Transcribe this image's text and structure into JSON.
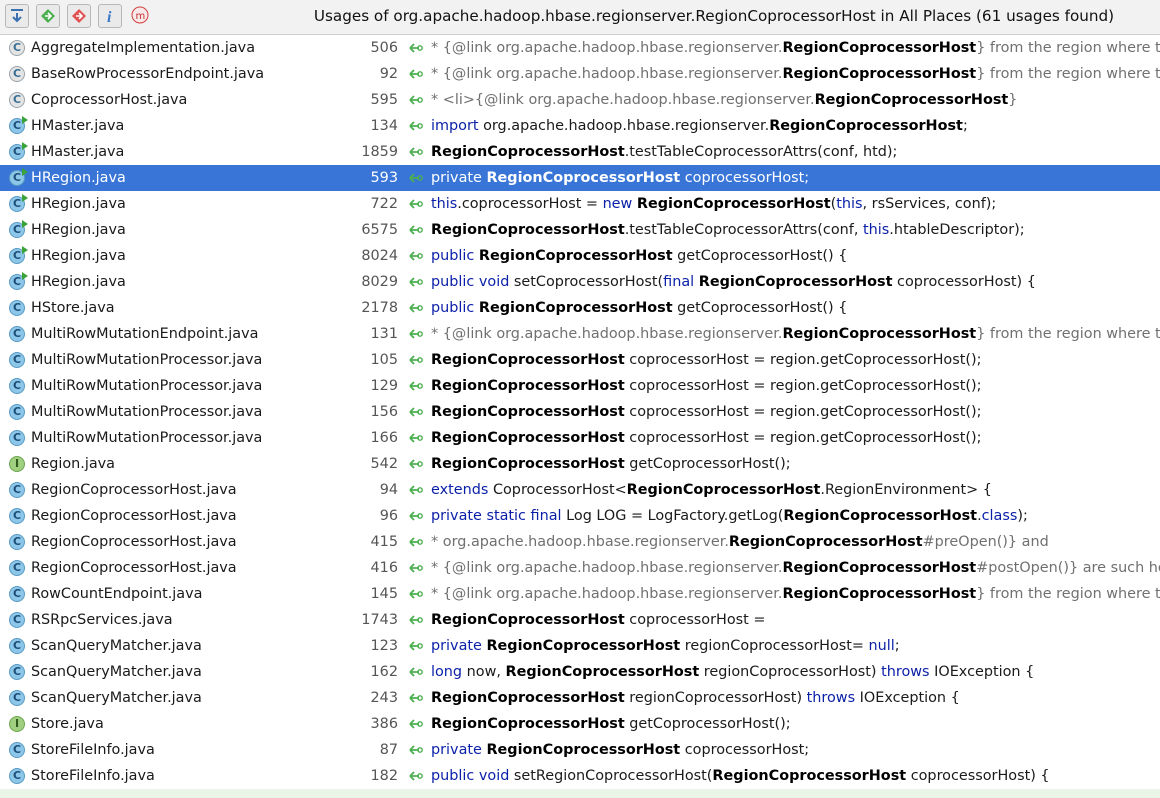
{
  "toolbar": {
    "buttons": [
      {
        "name": "expand-all-icon"
      },
      {
        "name": "next-occurrence-icon"
      },
      {
        "name": "previous-occurrence-icon"
      },
      {
        "name": "info-icon"
      },
      {
        "name": "merge-usages-icon"
      }
    ],
    "title": "Usages of org.apache.hadoop.hbase.regionserver.RegionCoprocessorHost in All Places (61 usages found)"
  },
  "colors": {
    "selection": "#3875d7",
    "keyword": "#0a1fa8",
    "comment": "#707070",
    "usage_arrow": "#4caf50"
  },
  "rows": [
    {
      "file": "AggregateImplementation.java",
      "icon": "abstract",
      "line": "506",
      "parts": [
        {
          "t": "  * {@link org.apache.hadoop.hbase.regionserver.",
          "s": "cm"
        },
        {
          "t": "RegionCoprocessorHost",
          "s": "b"
        },
        {
          "t": "} from the region where th",
          "s": "cm"
        }
      ]
    },
    {
      "file": "BaseRowProcessorEndpoint.java",
      "icon": "abstract",
      "line": "92",
      "parts": [
        {
          "t": "  * {@link org.apache.hadoop.hbase.regionserver.",
          "s": "cm"
        },
        {
          "t": "RegionCoprocessorHost",
          "s": "b"
        },
        {
          "t": "} from the region where th",
          "s": "cm"
        }
      ]
    },
    {
      "file": "CoprocessorHost.java",
      "icon": "abstract",
      "line": "595",
      "parts": [
        {
          "t": "  *   <li>{@link org.apache.hadoop.hbase.regionserver.",
          "s": "cm"
        },
        {
          "t": "RegionCoprocessorHost",
          "s": "b"
        },
        {
          "t": "}",
          "s": "cm"
        }
      ]
    },
    {
      "file": "HMaster.java",
      "icon": "runnable",
      "line": "134",
      "parts": [
        {
          "t": "import",
          "s": "kw"
        },
        {
          "t": " org.apache.hadoop.hbase.regionserver.",
          "s": ""
        },
        {
          "t": "RegionCoprocessorHost",
          "s": "b"
        },
        {
          "t": ";",
          "s": ""
        }
      ]
    },
    {
      "file": "HMaster.java",
      "icon": "runnable",
      "line": "1859",
      "parts": [
        {
          "t": "RegionCoprocessorHost",
          "s": "b"
        },
        {
          "t": ".testTableCoprocessorAttrs(conf, htd);",
          "s": ""
        }
      ]
    },
    {
      "file": "HRegion.java",
      "icon": "runnable",
      "line": "593",
      "selected": true,
      "parts": [
        {
          "t": "private ",
          "s": "kw"
        },
        {
          "t": "RegionCoprocessorHost",
          "s": "b"
        },
        {
          "t": " coprocessorHost;",
          "s": ""
        }
      ]
    },
    {
      "file": "HRegion.java",
      "icon": "runnable",
      "line": "722",
      "parts": [
        {
          "t": "this",
          "s": "kw"
        },
        {
          "t": ".coprocessorHost = ",
          "s": ""
        },
        {
          "t": "new ",
          "s": "kw"
        },
        {
          "t": "RegionCoprocessorHost",
          "s": "b"
        },
        {
          "t": "(",
          "s": ""
        },
        {
          "t": "this",
          "s": "kw"
        },
        {
          "t": ", rsServices, conf);",
          "s": ""
        }
      ]
    },
    {
      "file": "HRegion.java",
      "icon": "runnable",
      "line": "6575",
      "parts": [
        {
          "t": "RegionCoprocessorHost",
          "s": "b"
        },
        {
          "t": ".testTableCoprocessorAttrs(conf, ",
          "s": ""
        },
        {
          "t": "this",
          "s": "kw"
        },
        {
          "t": ".htableDescriptor);",
          "s": ""
        }
      ]
    },
    {
      "file": "HRegion.java",
      "icon": "runnable",
      "line": "8024",
      "parts": [
        {
          "t": "public ",
          "s": "kw"
        },
        {
          "t": "RegionCoprocessorHost",
          "s": "b"
        },
        {
          "t": " getCoprocessorHost() {",
          "s": ""
        }
      ]
    },
    {
      "file": "HRegion.java",
      "icon": "runnable",
      "line": "8029",
      "parts": [
        {
          "t": "public void ",
          "s": "kw"
        },
        {
          "t": "setCoprocessorHost(",
          "s": ""
        },
        {
          "t": "final ",
          "s": "kw"
        },
        {
          "t": "RegionCoprocessorHost",
          "s": "b"
        },
        {
          "t": " coprocessorHost) {",
          "s": ""
        }
      ]
    },
    {
      "file": "HStore.java",
      "icon": "class",
      "line": "2178",
      "parts": [
        {
          "t": "public ",
          "s": "kw"
        },
        {
          "t": "RegionCoprocessorHost",
          "s": "b"
        },
        {
          "t": " getCoprocessorHost() {",
          "s": ""
        }
      ]
    },
    {
      "file": "MultiRowMutationEndpoint.java",
      "icon": "class",
      "line": "131",
      "parts": [
        {
          "t": "  * {@link org.apache.hadoop.hbase.regionserver.",
          "s": "cm"
        },
        {
          "t": "RegionCoprocessorHost",
          "s": "b"
        },
        {
          "t": "} from the region where th",
          "s": "cm"
        }
      ]
    },
    {
      "file": "MultiRowMutationProcessor.java",
      "icon": "class",
      "line": "105",
      "parts": [
        {
          "t": "RegionCoprocessorHost",
          "s": "b"
        },
        {
          "t": " coprocessorHost = region.getCoprocessorHost();",
          "s": ""
        }
      ]
    },
    {
      "file": "MultiRowMutationProcessor.java",
      "icon": "class",
      "line": "129",
      "parts": [
        {
          "t": "RegionCoprocessorHost",
          "s": "b"
        },
        {
          "t": " coprocessorHost = region.getCoprocessorHost();",
          "s": ""
        }
      ]
    },
    {
      "file": "MultiRowMutationProcessor.java",
      "icon": "class",
      "line": "156",
      "parts": [
        {
          "t": "RegionCoprocessorHost",
          "s": "b"
        },
        {
          "t": " coprocessorHost = region.getCoprocessorHost();",
          "s": ""
        }
      ]
    },
    {
      "file": "MultiRowMutationProcessor.java",
      "icon": "class",
      "line": "166",
      "parts": [
        {
          "t": "RegionCoprocessorHost",
          "s": "b"
        },
        {
          "t": " coprocessorHost = region.getCoprocessorHost();",
          "s": ""
        }
      ]
    },
    {
      "file": "Region.java",
      "icon": "iface",
      "line": "542",
      "parts": [
        {
          "t": "RegionCoprocessorHost",
          "s": "b"
        },
        {
          "t": " getCoprocessorHost();",
          "s": ""
        }
      ]
    },
    {
      "file": "RegionCoprocessorHost.java",
      "icon": "class",
      "line": "94",
      "parts": [
        {
          "t": "extends ",
          "s": "kw"
        },
        {
          "t": "CoprocessorHost<",
          "s": ""
        },
        {
          "t": "RegionCoprocessorHost",
          "s": "b"
        },
        {
          "t": ".RegionEnvironment> {",
          "s": ""
        }
      ]
    },
    {
      "file": "RegionCoprocessorHost.java",
      "icon": "class",
      "line": "96",
      "parts": [
        {
          "t": "private static final ",
          "s": "kw"
        },
        {
          "t": "Log LOG = LogFactory.getLog(",
          "s": ""
        },
        {
          "t": "RegionCoprocessorHost",
          "s": "b"
        },
        {
          "t": ".",
          "s": ""
        },
        {
          "t": "class",
          "s": "kw"
        },
        {
          "t": ");",
          "s": ""
        }
      ]
    },
    {
      "file": "RegionCoprocessorHost.java",
      "icon": "class",
      "line": "415",
      "parts": [
        {
          "t": "  * org.apache.hadoop.hbase.regionserver.",
          "s": "cm"
        },
        {
          "t": "RegionCoprocessorHost",
          "s": "b"
        },
        {
          "t": "#preOpen()} and",
          "s": "cm"
        }
      ]
    },
    {
      "file": "RegionCoprocessorHost.java",
      "icon": "class",
      "line": "416",
      "parts": [
        {
          "t": "  * {@link org.apache.hadoop.hbase.regionserver.",
          "s": "cm"
        },
        {
          "t": "RegionCoprocessorHost",
          "s": "b"
        },
        {
          "t": "#postOpen()} are such ho",
          "s": "cm"
        }
      ]
    },
    {
      "file": "RowCountEndpoint.java",
      "icon": "class",
      "line": "145",
      "parts": [
        {
          "t": "  * {@link org.apache.hadoop.hbase.regionserver.",
          "s": "cm"
        },
        {
          "t": "RegionCoprocessorHost",
          "s": "b"
        },
        {
          "t": "} from the region where th",
          "s": "cm"
        }
      ]
    },
    {
      "file": "RSRpcServices.java",
      "icon": "class",
      "line": "1743",
      "parts": [
        {
          "t": "RegionCoprocessorHost",
          "s": "b"
        },
        {
          "t": " coprocessorHost =",
          "s": ""
        }
      ]
    },
    {
      "file": "ScanQueryMatcher.java",
      "icon": "class",
      "line": "123",
      "parts": [
        {
          "t": "private ",
          "s": "kw"
        },
        {
          "t": "RegionCoprocessorHost",
          "s": "b"
        },
        {
          "t": " regionCoprocessorHost= ",
          "s": ""
        },
        {
          "t": "null",
          "s": "kw"
        },
        {
          "t": ";",
          "s": ""
        }
      ]
    },
    {
      "file": "ScanQueryMatcher.java",
      "icon": "class",
      "line": "162",
      "parts": [
        {
          "t": "long ",
          "s": "kw"
        },
        {
          "t": "now, ",
          "s": ""
        },
        {
          "t": "RegionCoprocessorHost",
          "s": "b"
        },
        {
          "t": " regionCoprocessorHost) ",
          "s": ""
        },
        {
          "t": "throws ",
          "s": "kw"
        },
        {
          "t": "IOException {",
          "s": ""
        }
      ]
    },
    {
      "file": "ScanQueryMatcher.java",
      "icon": "class",
      "line": "243",
      "parts": [
        {
          "t": "RegionCoprocessorHost",
          "s": "b"
        },
        {
          "t": " regionCoprocessorHost) ",
          "s": ""
        },
        {
          "t": "throws ",
          "s": "kw"
        },
        {
          "t": "IOException {",
          "s": ""
        }
      ]
    },
    {
      "file": "Store.java",
      "icon": "iface",
      "line": "386",
      "parts": [
        {
          "t": "RegionCoprocessorHost",
          "s": "b"
        },
        {
          "t": " getCoprocessorHost();",
          "s": ""
        }
      ]
    },
    {
      "file": "StoreFileInfo.java",
      "icon": "class",
      "line": "87",
      "parts": [
        {
          "t": "private ",
          "s": "kw"
        },
        {
          "t": "RegionCoprocessorHost",
          "s": "b"
        },
        {
          "t": " coprocessorHost;",
          "s": ""
        }
      ]
    },
    {
      "file": "StoreFileInfo.java",
      "icon": "class",
      "line": "182",
      "parts": [
        {
          "t": "public void ",
          "s": "kw"
        },
        {
          "t": "setRegionCoprocessorHost(",
          "s": ""
        },
        {
          "t": "RegionCoprocessorHost",
          "s": "b"
        },
        {
          "t": " coprocessorHost) {",
          "s": ""
        }
      ]
    }
  ]
}
